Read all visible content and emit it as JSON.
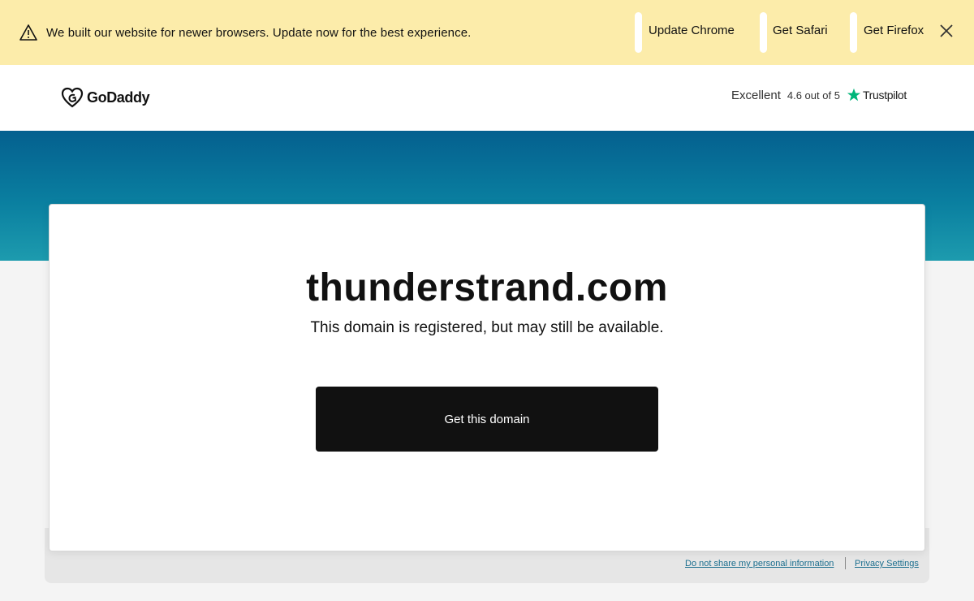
{
  "banner": {
    "message": "We built our website for newer browsers. Update now for the best experience.",
    "links": [
      "Update Chrome",
      "Get Safari",
      "Get Firefox"
    ],
    "warning_icon": "warning-triangle-icon",
    "close_icon": "close-icon",
    "background_color": "#fcecaa"
  },
  "header": {
    "logo_text": "GoDaddy",
    "trustpilot": {
      "rating_word": "Excellent",
      "score_text": "4.6 out of 5",
      "brand": "Trustpilot",
      "star_color": "#00b67a"
    }
  },
  "main": {
    "domain": "thunderstrand.com",
    "subtitle": "This domain is registered, but may still be available.",
    "cta_label": "Get this domain"
  },
  "footer": {
    "links": [
      "Do not share my personal information",
      "Privacy Settings"
    ]
  },
  "colors": {
    "hero_gradient_top": "#04608f",
    "hero_gradient_bottom": "#1d9bae",
    "cta_bg": "#111111",
    "link": "#1a6e8e"
  }
}
